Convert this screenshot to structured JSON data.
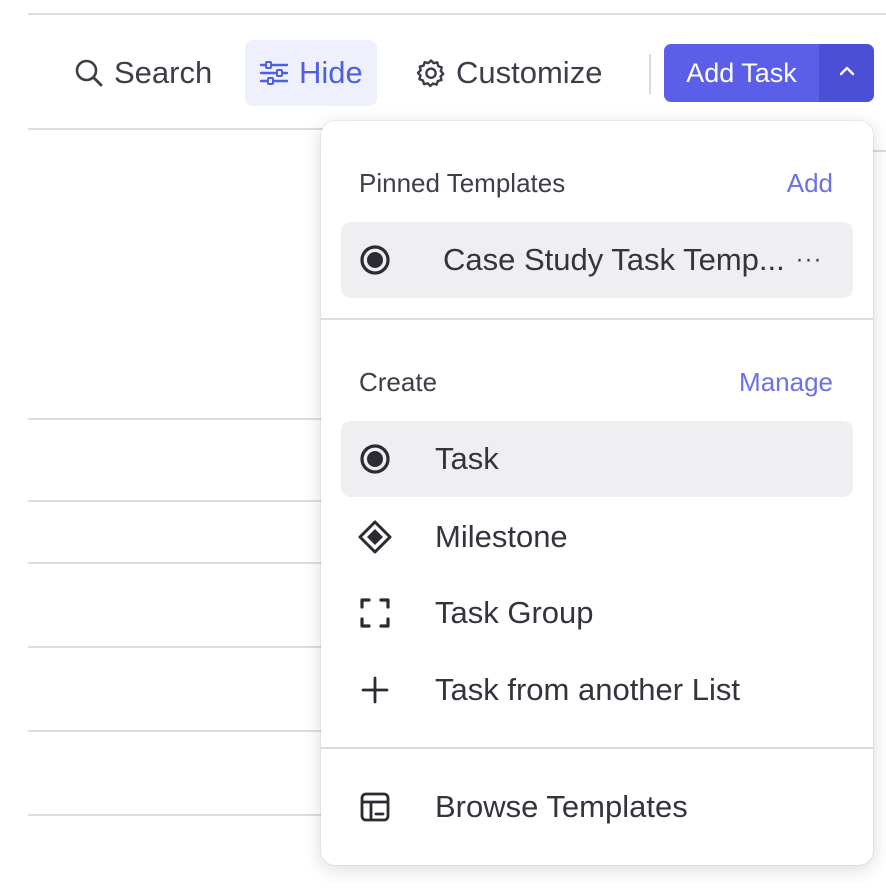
{
  "toolbar": {
    "search_label": "Search",
    "hide_label": "Hide",
    "customize_label": "Customize",
    "add_task_label": "Add Task",
    "icons": {
      "search": "search-icon",
      "hide": "sliders-icon",
      "customize": "gear-icon",
      "caret": "chevron-up-icon"
    }
  },
  "dropdown": {
    "pinned": {
      "title": "Pinned Templates",
      "action": "Add",
      "items": [
        {
          "label": "Case Study Task Temp...",
          "icon": "task-circle-icon",
          "more": "···"
        }
      ]
    },
    "create": {
      "title": "Create",
      "action": "Manage",
      "items": [
        {
          "label": "Task",
          "icon": "task-circle-icon"
        },
        {
          "label": "Milestone",
          "icon": "diamond-icon"
        },
        {
          "label": "Task Group",
          "icon": "group-bracket-icon"
        },
        {
          "label": "Task from another List",
          "icon": "plus-icon"
        }
      ]
    },
    "footer": {
      "items": [
        {
          "label": "Browse Templates",
          "icon": "template-layout-icon"
        }
      ]
    }
  },
  "colors": {
    "accent": "#5a5ee9",
    "accent_dark": "#4b4fd6",
    "link": "#6a72e8",
    "hide_bg": "#eef1fd",
    "row_highlight": "#efeff2"
  }
}
